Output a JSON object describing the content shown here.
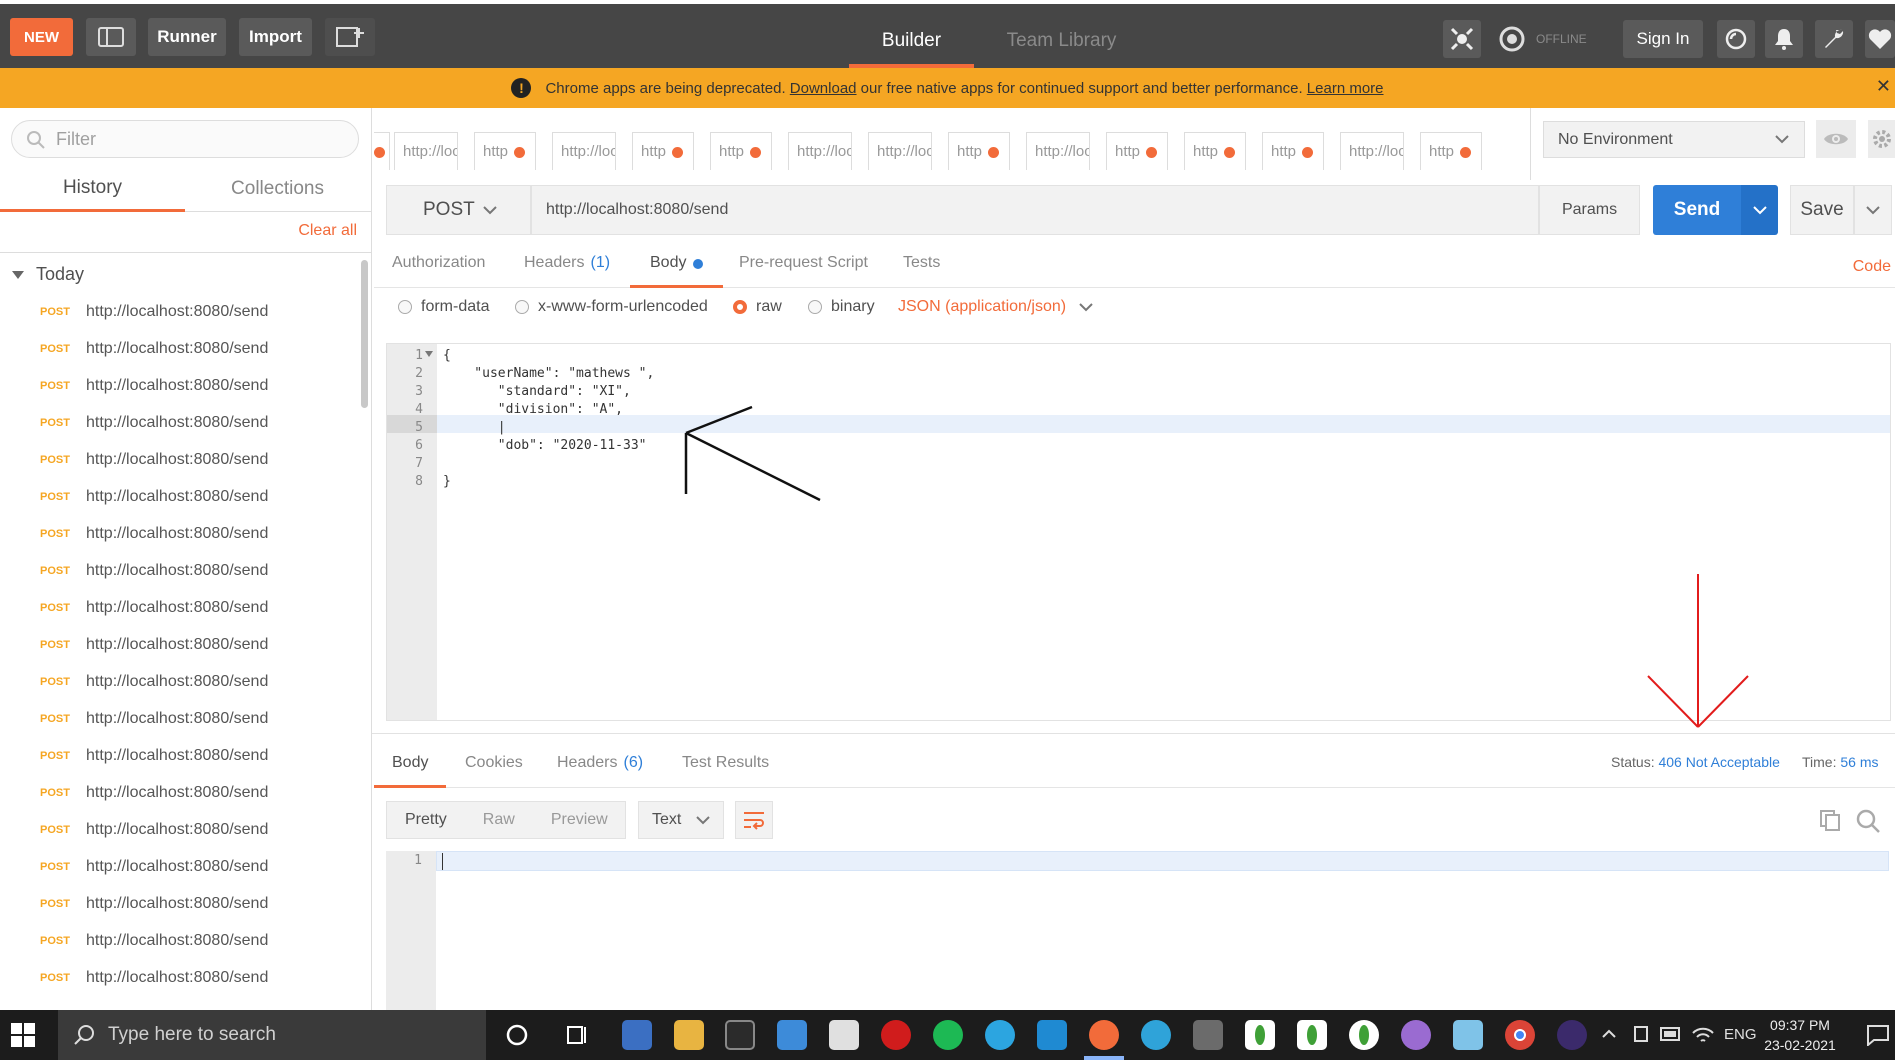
{
  "toolbar": {
    "new_label": "NEW",
    "runner_label": "Runner",
    "import_label": "Import",
    "builder_tab": "Builder",
    "team_library_tab": "Team Library",
    "offline_label": "OFFLINE",
    "sign_in_label": "Sign In"
  },
  "banner": {
    "text_before": "Chrome apps are being deprecated. ",
    "download_link": "Download",
    "text_after": " our free native apps for continued support and better performance. ",
    "learn_more_link": "Learn more"
  },
  "sidebar": {
    "filter_placeholder": "Filter",
    "history_tab": "History",
    "collections_tab": "Collections",
    "clear_all": "Clear all",
    "group_label": "Today",
    "history_items": [
      {
        "method": "POST",
        "url": "http://localhost:8080/send"
      },
      {
        "method": "POST",
        "url": "http://localhost:8080/send"
      },
      {
        "method": "POST",
        "url": "http://localhost:8080/send"
      },
      {
        "method": "POST",
        "url": "http://localhost:8080/send"
      },
      {
        "method": "POST",
        "url": "http://localhost:8080/send"
      },
      {
        "method": "POST",
        "url": "http://localhost:8080/send"
      },
      {
        "method": "POST",
        "url": "http://localhost:8080/send"
      },
      {
        "method": "POST",
        "url": "http://localhost:8080/send"
      },
      {
        "method": "POST",
        "url": "http://localhost:8080/send"
      },
      {
        "method": "POST",
        "url": "http://localhost:8080/send"
      },
      {
        "method": "POST",
        "url": "http://localhost:8080/send"
      },
      {
        "method": "POST",
        "url": "http://localhost:8080/send"
      },
      {
        "method": "POST",
        "url": "http://localhost:8080/send"
      },
      {
        "method": "POST",
        "url": "http://localhost:8080/send"
      },
      {
        "method": "POST",
        "url": "http://localhost:8080/send"
      },
      {
        "method": "POST",
        "url": "http://localhost:8080/send"
      },
      {
        "method": "POST",
        "url": "http://localhost:8080/send"
      },
      {
        "method": "POST",
        "url": "http://localhost:8080/send"
      },
      {
        "method": "POST",
        "url": "http://localhost:8080/send"
      }
    ]
  },
  "request_tabs": [
    {
      "label": "http://loca"
    },
    {
      "label": "http"
    },
    {
      "label": "http://loca"
    },
    {
      "label": "http"
    },
    {
      "label": "http"
    },
    {
      "label": "http://loca"
    },
    {
      "label": "http://loca"
    },
    {
      "label": "http"
    },
    {
      "label": "http://loca"
    },
    {
      "label": "http"
    },
    {
      "label": "http"
    },
    {
      "label": "http"
    },
    {
      "label": "http://loca"
    },
    {
      "label": "http"
    }
  ],
  "environment": {
    "selected": "No Environment"
  },
  "request": {
    "method": "POST",
    "url": "http://localhost:8080/send",
    "params_label": "Params",
    "send_label": "Send",
    "save_label": "Save"
  },
  "request_subtabs": {
    "authorization": "Authorization",
    "headers": "Headers",
    "headers_count": "(1)",
    "body": "Body",
    "pre_request": "Pre-request Script",
    "tests": "Tests",
    "code": "Code"
  },
  "body_types": {
    "form_data": "form-data",
    "urlencoded": "x-www-form-urlencoded",
    "raw": "raw",
    "binary": "binary",
    "content_type": "JSON (application/json)"
  },
  "editor_lines": [
    {
      "no": "1",
      "text": "{"
    },
    {
      "no": "2",
      "text": "    \"userName\": \"mathews \","
    },
    {
      "no": "3",
      "text": "       \"standard\": \"XI\","
    },
    {
      "no": "4",
      "text": "       \"division\": \"A\","
    },
    {
      "no": "5",
      "text": "       |"
    },
    {
      "no": "6",
      "text": "       \"dob\": \"2020-11-33\""
    },
    {
      "no": "7",
      "text": ""
    },
    {
      "no": "8",
      "text": "}"
    }
  ],
  "response": {
    "body_tab": "Body",
    "cookies_tab": "Cookies",
    "headers_tab": "Headers",
    "headers_count": "(6)",
    "test_results_tab": "Test Results",
    "status_label": "Status:",
    "status_value": "406 Not Acceptable",
    "time_label": "Time:",
    "time_value": "56 ms",
    "pretty": "Pretty",
    "raw": "Raw",
    "preview": "Preview",
    "format": "Text",
    "line_no": "1"
  },
  "taskbar": {
    "search_placeholder": "Type here to search",
    "language": "ENG",
    "time": "09:37 PM",
    "date": "23-02-2021"
  },
  "colors": {
    "accent": "#f26b3a",
    "send_blue": "#2f7fd8",
    "banner": "#f5a623",
    "topbar": "#464646"
  }
}
